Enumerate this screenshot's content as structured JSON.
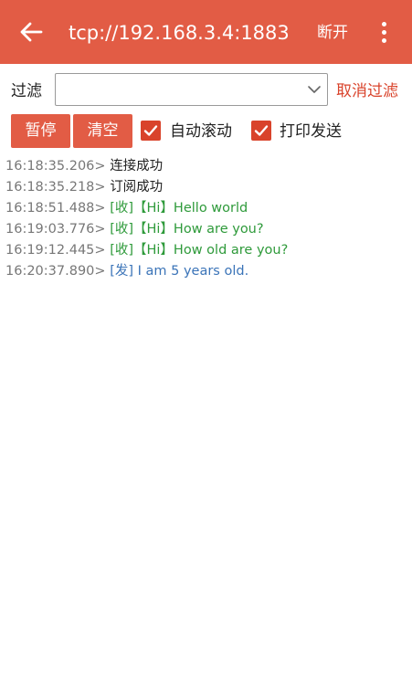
{
  "header": {
    "title": "tcp://192.168.3.4:1883",
    "disconnect_label": "断开",
    "back_icon": "arrow-left-icon",
    "more_icon": "more-vertical-icon"
  },
  "filter": {
    "label": "过滤",
    "value": "",
    "cancel_label": "取消过滤"
  },
  "controls": {
    "pause_label": "暂停",
    "clear_label": "清空",
    "auto_scroll_label": "自动滚动",
    "auto_scroll_checked": true,
    "print_send_label": "打印发送",
    "print_send_checked": true
  },
  "colors": {
    "accent": "#e25c45",
    "received": "#2e9a3a",
    "sent": "#3b74b8"
  },
  "log": [
    {
      "time": "16:18:35.206",
      "sep": ">",
      "text": "连接成功",
      "kind": "sys"
    },
    {
      "time": "16:18:35.218",
      "sep": ">",
      "text": "订阅成功",
      "kind": "sys"
    },
    {
      "time": "16:18:51.488",
      "sep": ">",
      "text": "[收]【Hi】Hello world",
      "kind": "recv"
    },
    {
      "time": "16:19:03.776",
      "sep": ">",
      "text": "[收]【Hi】How are you?",
      "kind": "recv"
    },
    {
      "time": "16:19:12.445",
      "sep": ">",
      "text": "[收]【Hi】How old are you?",
      "kind": "recv"
    },
    {
      "time": "16:20:37.890",
      "sep": ">",
      "text": "[发] I am 5 years old.",
      "kind": "send"
    }
  ]
}
